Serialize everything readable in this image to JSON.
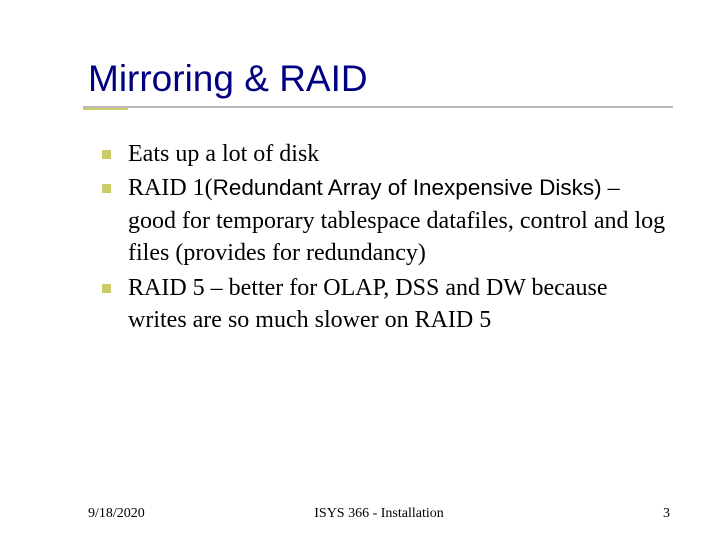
{
  "title": "Mirroring & RAID",
  "bullets": [
    {
      "text_a": "Eats up a lot of disk",
      "sans": "",
      "text_b": ""
    },
    {
      "text_a": "RAID 1(",
      "sans": "Redundant Array of Inexpensive Disks)",
      "text_b": " – good for temporary tablespace datafiles, control and log files (provides for redundancy)"
    },
    {
      "text_a": "RAID 5 – better for OLAP, DSS and DW because writes are so much slower on RAID 5",
      "sans": "",
      "text_b": ""
    }
  ],
  "footer": {
    "date": "9/18/2020",
    "center": "ISYS 366 - Installation",
    "page": "3"
  }
}
